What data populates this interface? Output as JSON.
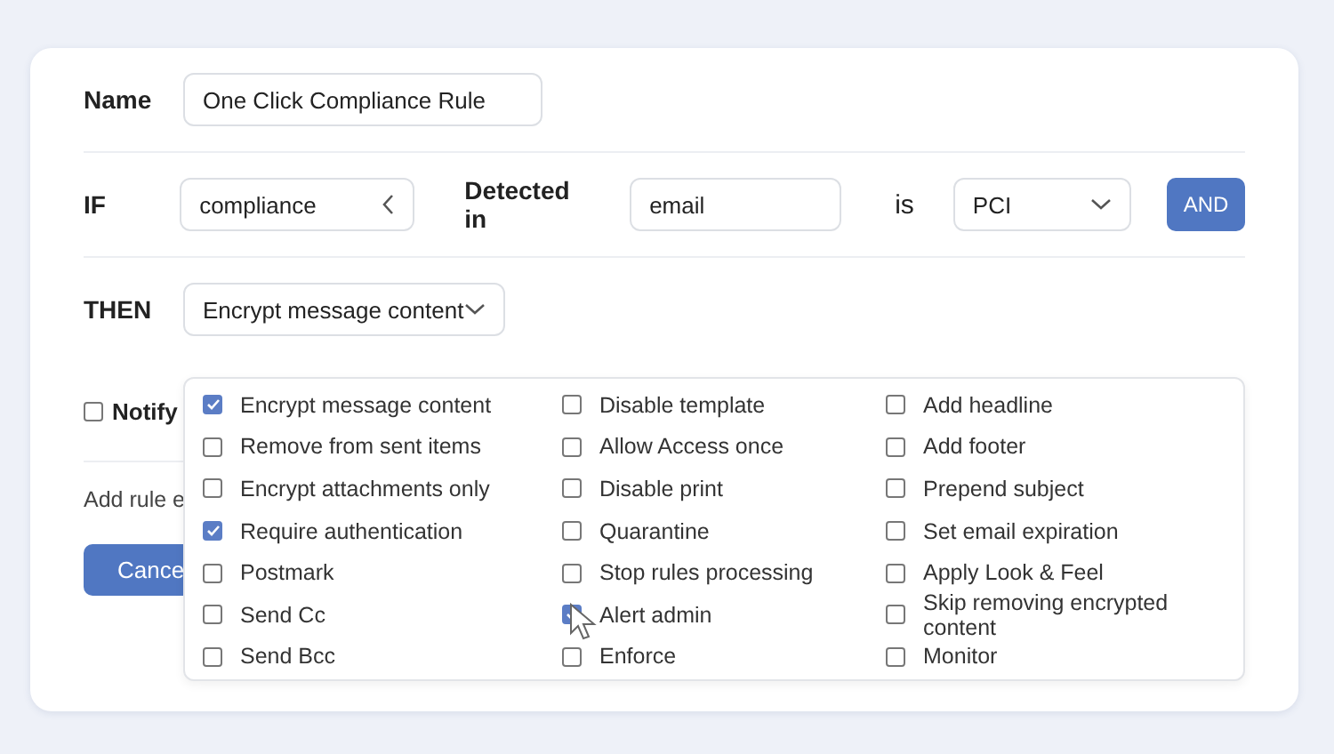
{
  "name_row": {
    "label": "Name",
    "value": "One Click Compliance Rule"
  },
  "condition": {
    "label": "IF",
    "field": "compliance",
    "detected_label": "Detected in",
    "detected_value": "email",
    "is_label": "is",
    "type_value": "PCI",
    "and_button": "AND"
  },
  "action": {
    "label": "THEN",
    "value": "Encrypt message content"
  },
  "notify": {
    "label": "Notify",
    "checked": false
  },
  "exception_link": "Add rule e",
  "cancel_button": "Cance",
  "options": [
    [
      {
        "label": "Encrypt message content",
        "checked": true
      },
      {
        "label": "Remove from sent items",
        "checked": false
      },
      {
        "label": "Encrypt attachments only",
        "checked": false
      },
      {
        "label": "Require authentication",
        "checked": true
      },
      {
        "label": "Postmark",
        "checked": false
      },
      {
        "label": "Send Cc",
        "checked": false
      },
      {
        "label": "Send Bcc",
        "checked": false
      }
    ],
    [
      {
        "label": "Disable template",
        "checked": false
      },
      {
        "label": "Allow Access once",
        "checked": false
      },
      {
        "label": "Disable print",
        "checked": false
      },
      {
        "label": "Quarantine",
        "checked": false
      },
      {
        "label": "Stop rules processing",
        "checked": false
      },
      {
        "label": "Alert admin",
        "checked": true
      },
      {
        "label": "Enforce",
        "checked": false
      }
    ],
    [
      {
        "label": "Add headline",
        "checked": false
      },
      {
        "label": "Add footer",
        "checked": false
      },
      {
        "label": "Prepend subject",
        "checked": false
      },
      {
        "label": "Set email expiration",
        "checked": false
      },
      {
        "label": "Apply Look & Feel",
        "checked": false
      },
      {
        "label": "Skip removing encrypted content",
        "checked": false
      },
      {
        "label": "Monitor",
        "checked": false
      }
    ]
  ]
}
